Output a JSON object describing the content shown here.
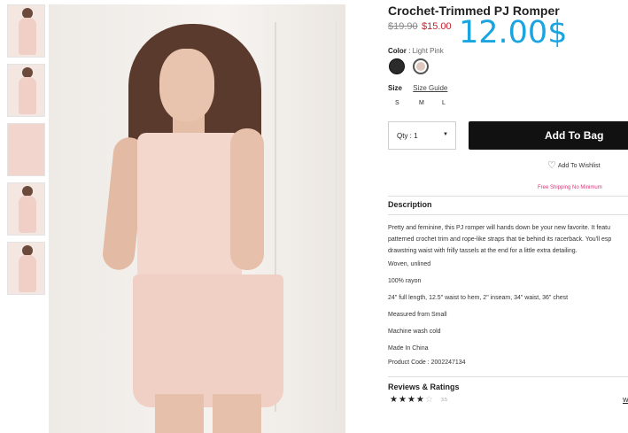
{
  "product": {
    "title": "Crochet-Trimmed PJ Romper",
    "price_original": "$19.90",
    "price_sale": "$15.00",
    "overlay_price": "12.00$"
  },
  "color": {
    "label": "Color",
    "selected": "Light Pink",
    "swatches": [
      {
        "name": "black",
        "hex": "#2b2b2b"
      },
      {
        "name": "light-pink",
        "hex": "#ddc9bf"
      }
    ]
  },
  "size": {
    "label": "Size",
    "guide_link": "Size Guide",
    "options": [
      "S",
      "M",
      "L"
    ]
  },
  "quantity": {
    "label": "Qty : 1",
    "caret": "▼"
  },
  "add_to_bag": "Add To Bag",
  "wishlist": "Add To Wishlist",
  "free_shipping": "Free Shipping No Minimum",
  "description": {
    "heading": "Description",
    "paragraph": [
      "Pretty and feminine, this PJ romper will hands down be your new favorite. It featu",
      "patterned crochet trim and rope-like straps that tie behind its racerback. You'll esp",
      "drawstring waist with frilly tassels at the end for a little extra detailing."
    ],
    "specs": [
      "Woven, unlined",
      "100% rayon",
      "24\" full length, 12.5\" waist to hem, 2\" inseam, 34\" waist, 36\" chest",
      "Measured from Small",
      "Machine wash cold",
      "Made In China",
      "Product Code : 2002247134"
    ]
  },
  "reviews": {
    "heading": "Reviews & Ratings",
    "rating": "3.5",
    "write_link": "Wi"
  },
  "colors": {
    "accent_blue": "#1aa5e0",
    "sale_red": "#c8202f",
    "free_ship_pink": "#e0307a",
    "button_black": "#111111"
  },
  "icons": [
    "heart-icon",
    "star-icon",
    "dropdown-caret-icon"
  ]
}
